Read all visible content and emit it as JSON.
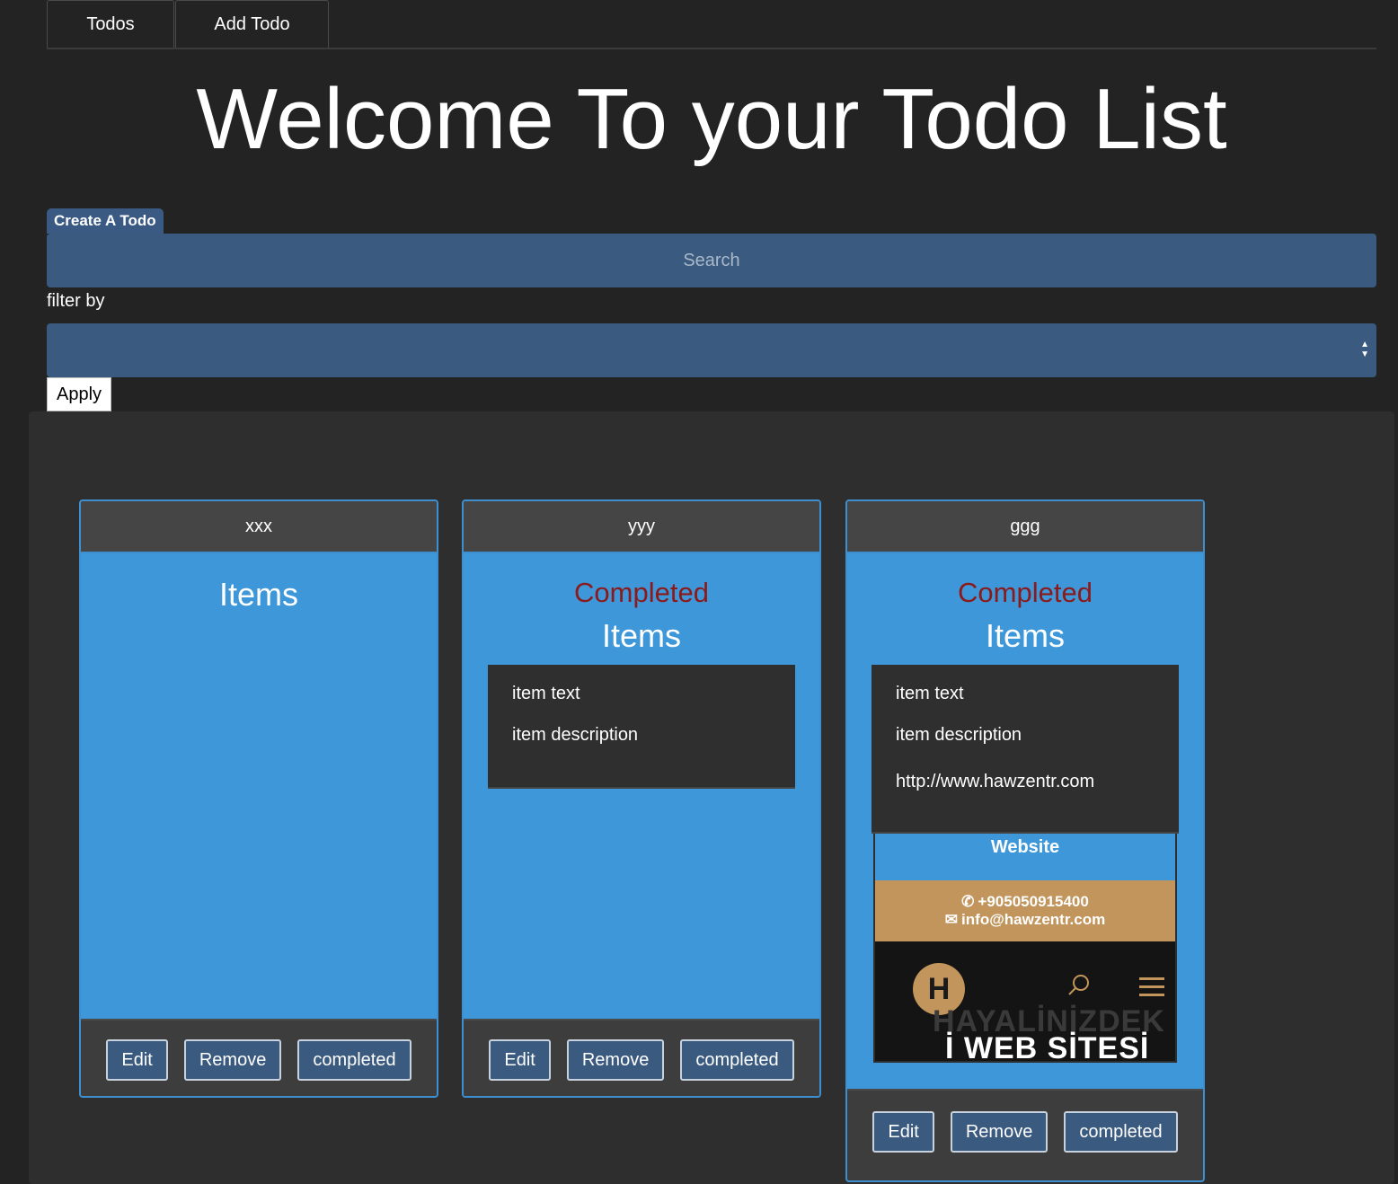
{
  "tabs": [
    {
      "label": "Todos"
    },
    {
      "label": "Add Todo"
    }
  ],
  "page_title": "Welcome To your Todo List",
  "create_badge": "Create A Todo",
  "search": {
    "placeholder": "Search"
  },
  "filter": {
    "label": "filter by",
    "selected": ""
  },
  "apply_label": "Apply",
  "cards": [
    {
      "title": "xxx",
      "completed_label": "",
      "items_label": "Items",
      "items": [],
      "buttons": {
        "edit": "Edit",
        "remove": "Remove",
        "completed": "completed"
      }
    },
    {
      "title": "yyy",
      "completed_label": "Completed",
      "items_label": "Items",
      "items": [
        {
          "text": "item text",
          "description": "item description"
        }
      ],
      "buttons": {
        "edit": "Edit",
        "remove": "Remove",
        "completed": "completed"
      }
    },
    {
      "title": "ggg",
      "completed_label": "Completed",
      "items_label": "Items",
      "items": [
        {
          "text": "item text",
          "description": "item description",
          "url": "http://www.hawzentr.com"
        }
      ],
      "preview": {
        "title": "Website",
        "phone": "+905050915400",
        "email": "info@hawzentr.com",
        "logo_letter": "H",
        "hero_faint": "HAYALİNİZDEK",
        "hero_text": "İ WEB SİTESİ"
      },
      "buttons": {
        "edit": "Edit",
        "remove": "Remove",
        "completed": "completed"
      }
    }
  ],
  "colors": {
    "background": "#232323",
    "input_blue": "#3a5a7f",
    "card_blue": "#3d97d9",
    "completed_red": "#8b1a1a",
    "brand_gold": "#c1955c"
  }
}
